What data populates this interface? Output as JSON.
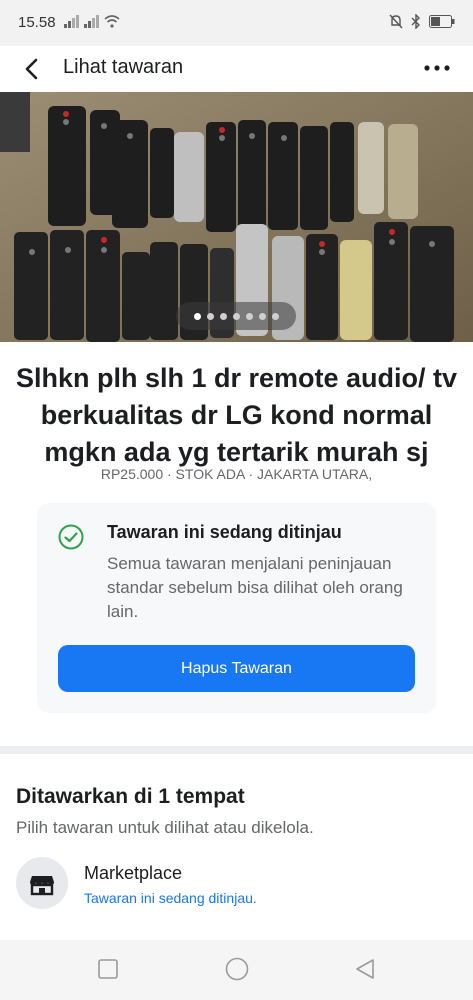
{
  "status_bar": {
    "time": "15.58"
  },
  "header": {
    "title": "Lihat tawaran"
  },
  "carousel": {
    "count": 7,
    "active_index": 0
  },
  "listing": {
    "title": "Slhkn plh slh 1 dr remote audio/ tv berkualitas dr LG kond normal mgkn ada yg tertarik murah sj",
    "meta": "RP25.000 · STOK ADA · JAKARTA UTARA,"
  },
  "review_card": {
    "title": "Tawaran ini sedang ditinjau",
    "body": "Semua tawaran menjalani peninjauan standar sebelum bisa dilihat oleh orang lain.",
    "button_label": "Hapus Tawaran"
  },
  "offered": {
    "title": "Ditawarkan di 1 tempat",
    "subtitle": "Pilih tawaran untuk dilihat atau dikelola.",
    "places": [
      {
        "name": "Marketplace",
        "status": "Tawaran ini sedang ditinjau."
      }
    ]
  },
  "colors": {
    "accent": "#1877f2",
    "success": "#31a24c",
    "muted": "#65676b"
  }
}
